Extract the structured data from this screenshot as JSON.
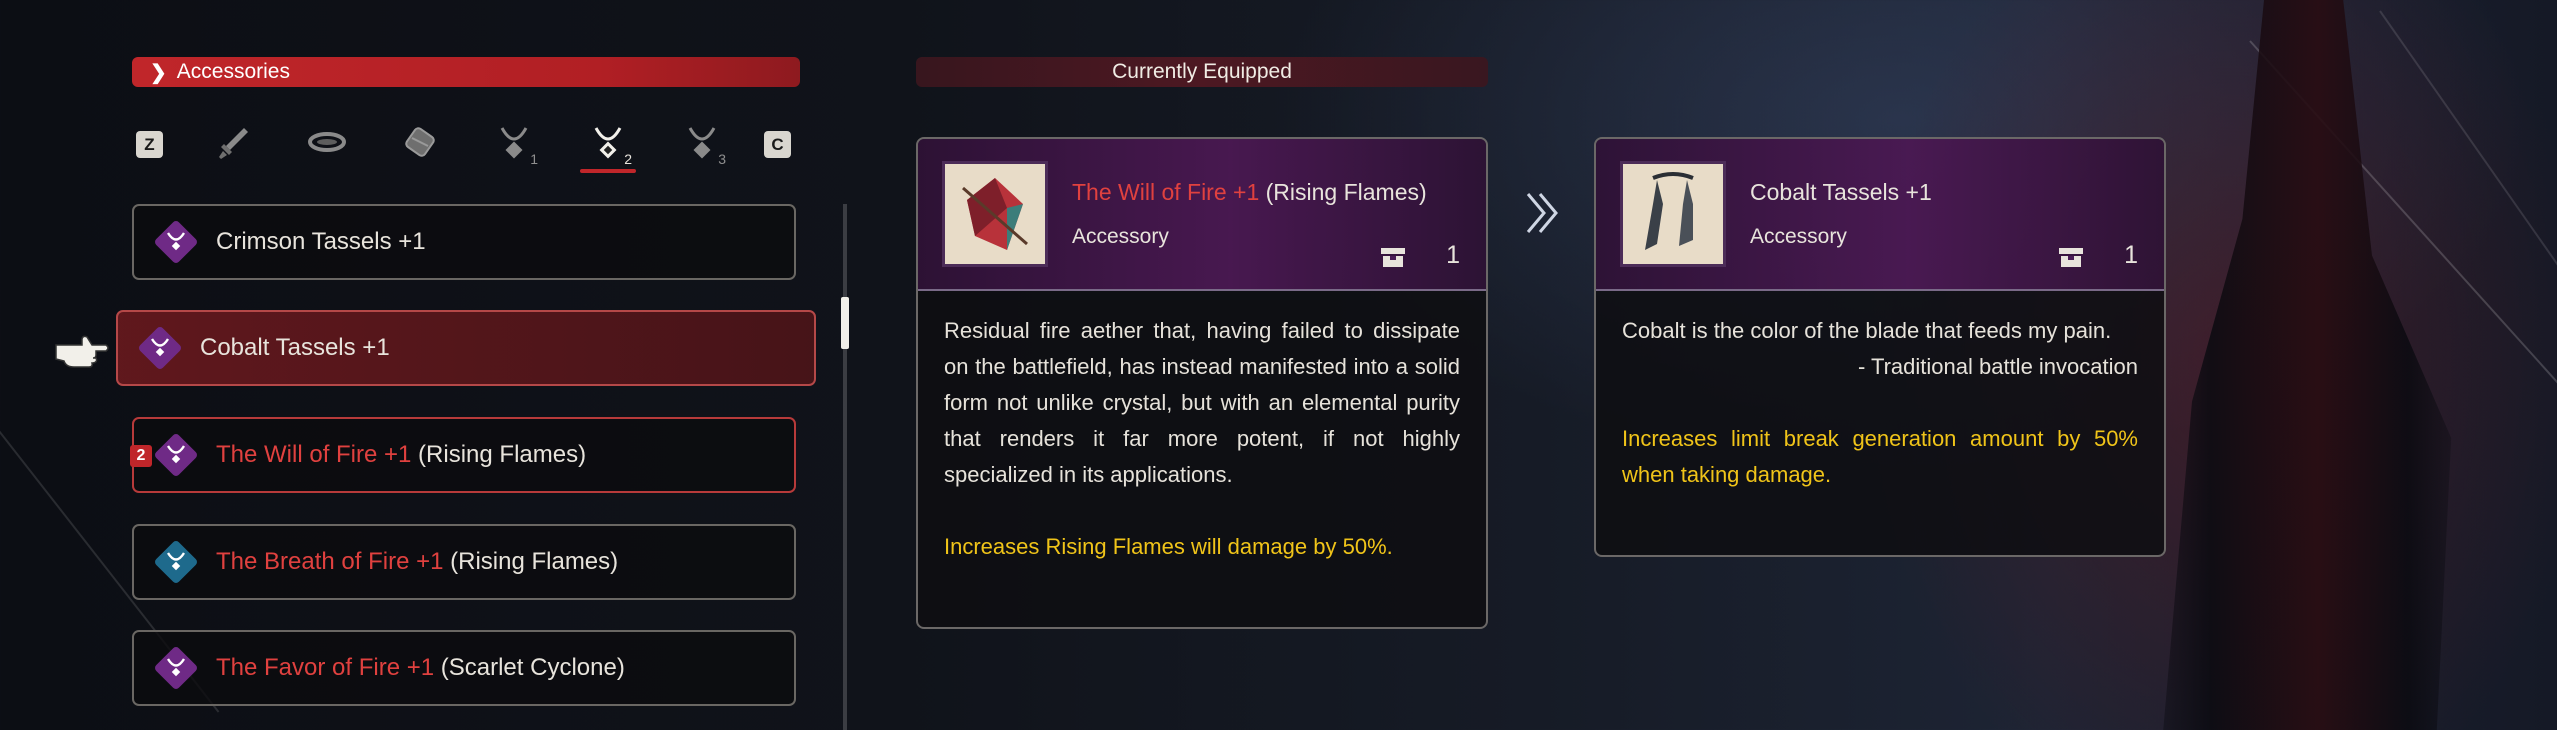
{
  "category": {
    "label": "Accessories"
  },
  "tabs": {
    "left_key": "Z",
    "right_key": "C",
    "items": [
      {
        "icon": "sword-icon",
        "num": ""
      },
      {
        "icon": "bracer-icon",
        "num": ""
      },
      {
        "icon": "belt-icon",
        "num": ""
      },
      {
        "icon": "accessory-icon",
        "num": "1"
      },
      {
        "icon": "accessory-icon",
        "num": "2",
        "active": true
      },
      {
        "icon": "accessory-icon",
        "num": "3"
      }
    ]
  },
  "list": {
    "items": [
      {
        "name": "Crimson Tassels +1",
        "gem_color": "#6f2a86"
      },
      {
        "name": "Cobalt Tassels +1",
        "gem_color": "#6f2a86",
        "selected": true
      },
      {
        "name_red": "The Will of Fire +1",
        "suffix": " (Rising Flames)",
        "gem_color": "#6f2a86",
        "badge": "2"
      },
      {
        "name_red": "The Breath of Fire +1",
        "suffix": " (Rising Flames)",
        "gem_color": "#1e6a8c"
      },
      {
        "name_red": "The Favor of Fire +1",
        "suffix": " (Scarlet Cyclone)",
        "gem_color": "#6f2a86"
      }
    ]
  },
  "equipped_label": "Currently Equipped",
  "current_card": {
    "title_red": "The Will of Fire +1",
    "title_suffix": " (Rising Flames)",
    "type": "Accessory",
    "qty": "1",
    "description": "Residual fire aether that, having failed to dissipate on the battlefield, has instead manifested into a solid form not unlike crystal, but with an elemental purity that renders it far more potent, if not highly specialized in its applications.",
    "effect": "Increases Rising Flames will damage by 50%."
  },
  "compare_card": {
    "title": "Cobalt Tassels +1",
    "type": "Accessory",
    "qty": "1",
    "description": "Cobalt is the color of the blade that feeds my pain.",
    "quote": "- Traditional battle invocation",
    "effect": "Increases limit break generation amount by 50% when taking damage."
  },
  "colors": {
    "accent_red": "#c0262a",
    "effect_yellow": "#f0c419",
    "name_red": "#e0413f"
  }
}
